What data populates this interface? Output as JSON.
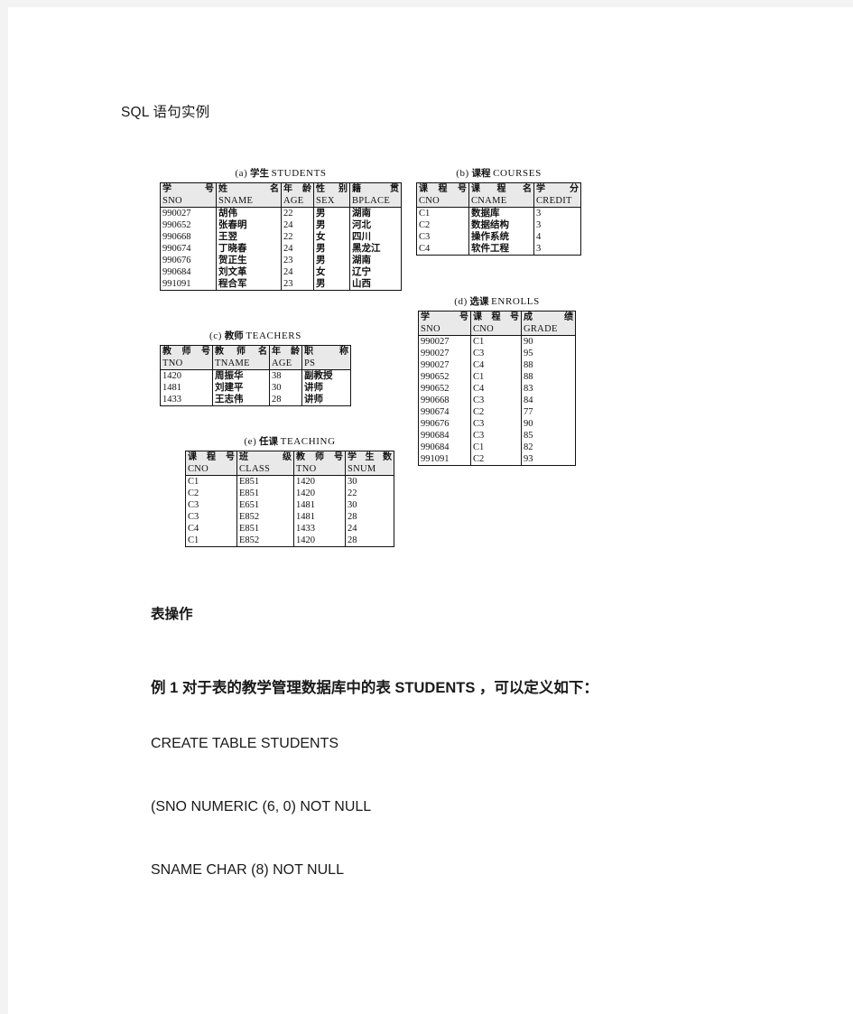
{
  "document": {
    "title": "SQL 语句实例",
    "section_heading": "表操作",
    "example_line": "例 1  对于表的教学管理数据库中的表 STUDENTS  ，可以定义如下：",
    "code_lines": [
      "CREATE   TABLE   STUDENTS",
      "(SNO        NUMERIC (6, 0) NOT NULL",
      "SNAME     CHAR (8) NOT NULL"
    ]
  },
  "figures": {
    "students": {
      "caption_label": "(a)",
      "caption_cn": "学生",
      "caption_en": "STUDENTS",
      "headers_cn": [
        "学    号",
        "姓       名",
        "年   龄",
        "性   别",
        "籍           贯"
      ],
      "headers_en": [
        "SNO",
        "SNAME",
        "AGE",
        "SEX",
        "BPLACE"
      ],
      "rows": [
        [
          "990027",
          "胡伟",
          "22",
          "男",
          "湖南"
        ],
        [
          "990652",
          "张春明",
          "24",
          "男",
          "河北"
        ],
        [
          "990668",
          "王翌",
          "22",
          "女",
          "四川"
        ],
        [
          "990674",
          "丁晓春",
          "24",
          "男",
          "黑龙江"
        ],
        [
          "990676",
          "贺正生",
          "23",
          "男",
          "湖南"
        ],
        [
          "990684",
          "刘文革",
          "24",
          "女",
          "辽宁"
        ],
        [
          "991091",
          "程合军",
          "23",
          "男",
          "山西"
        ]
      ]
    },
    "courses": {
      "caption_label": "(b)",
      "caption_cn": "课程",
      "caption_en": "COURSES",
      "headers_cn": [
        "课 程 号",
        "课     程     名",
        "学        分"
      ],
      "headers_en": [
        "CNO",
        "CNAME",
        "CREDIT"
      ],
      "rows": [
        [
          "C1",
          "数据库",
          "3"
        ],
        [
          "C2",
          "数据结构",
          "3"
        ],
        [
          "C3",
          "操作系统",
          "4"
        ],
        [
          "C4",
          "软件工程",
          "3"
        ]
      ]
    },
    "teachers": {
      "caption_label": "(c)",
      "caption_cn": "教师",
      "caption_en": "TEACHERS",
      "headers_cn": [
        "教 师 号",
        "教  师  名",
        "年   龄",
        "职        称"
      ],
      "headers_en": [
        "TNO",
        "TNAME",
        "AGE",
        "PS"
      ],
      "rows": [
        [
          "1420",
          "周振华",
          "38",
          "副教授"
        ],
        [
          "1481",
          "刘建平",
          "30",
          "讲师"
        ],
        [
          "1433",
          "王志伟",
          "28",
          "讲师"
        ]
      ]
    },
    "enrolls": {
      "caption_label": "(d)",
      "caption_cn": "选课",
      "caption_en": "ENROLLS",
      "headers_cn": [
        "学       号",
        "课 程 号",
        "成        绩"
      ],
      "headers_en": [
        "SNO",
        "CNO",
        "GRADE"
      ],
      "rows": [
        [
          "990027",
          "C1",
          "90"
        ],
        [
          "990027",
          "C3",
          "95"
        ],
        [
          "990027",
          "C4",
          "88"
        ],
        [
          "990652",
          "C1",
          "88"
        ],
        [
          "990652",
          "C4",
          "83"
        ],
        [
          "990668",
          "C3",
          "84"
        ],
        [
          "990674",
          "C2",
          "77"
        ],
        [
          "990676",
          "C3",
          "90"
        ],
        [
          "990684",
          "C3",
          "85"
        ],
        [
          "990684",
          "C1",
          "82"
        ],
        [
          "991091",
          "C2",
          "93"
        ]
      ]
    },
    "teaching": {
      "caption_label": "(e)",
      "caption_cn": "任课",
      "caption_en": "TEACHING",
      "headers_cn": [
        "课 程 号",
        "班       级",
        "教 师 号",
        "学 生 数"
      ],
      "headers_en": [
        "CNO",
        "CLASS",
        "TNO",
        "SNUM"
      ],
      "rows": [
        [
          "C1",
          "E851",
          "1420",
          "30"
        ],
        [
          "C2",
          "E851",
          "1420",
          "22"
        ],
        [
          "C3",
          "E651",
          "1481",
          "30"
        ],
        [
          "C3",
          "E852",
          "1481",
          "28"
        ],
        [
          "C4",
          "E851",
          "1433",
          "24"
        ],
        [
          "C1",
          "E852",
          "1420",
          "28"
        ]
      ]
    }
  },
  "colors": {
    "page_background": "#ffffff",
    "canvas_background": "#f3f3f3",
    "table_header_fill": "#e9e9e9",
    "table_border": "#111111",
    "text": "#1a1a1a"
  }
}
